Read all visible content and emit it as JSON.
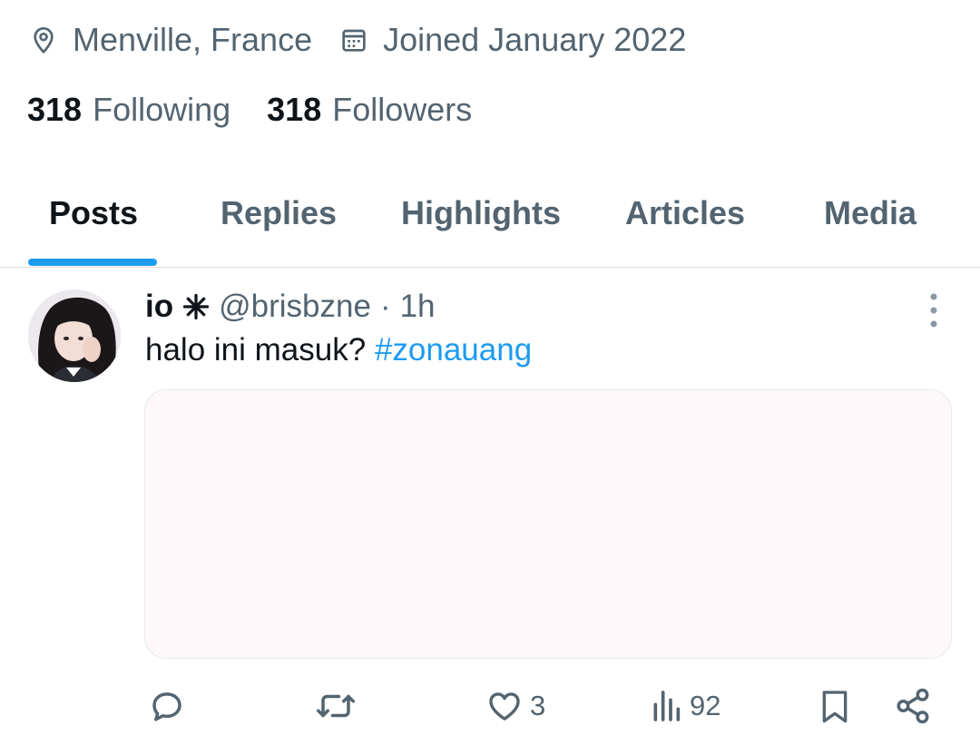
{
  "profile": {
    "location": "Menville, France",
    "joined": "Joined January 2022",
    "following_count": "318",
    "following_label": "Following",
    "followers_count": "318",
    "followers_label": "Followers"
  },
  "tabs": [
    {
      "label": "Posts",
      "active": true
    },
    {
      "label": "Replies",
      "active": false
    },
    {
      "label": "Highlights",
      "active": false
    },
    {
      "label": "Articles",
      "active": false
    },
    {
      "label": "Media",
      "active": false
    }
  ],
  "post": {
    "display_name": "io",
    "handle": "@brisbzne",
    "separator": "·",
    "time": "1h",
    "text": "halo ini masuk?",
    "hashtag": "#zonauang",
    "actions": {
      "reply_count": "",
      "repost_count": "",
      "like_count": "3",
      "views_count": "92"
    }
  },
  "colors": {
    "accent": "#1d9bf0",
    "secondary_text": "#536471",
    "primary_text": "#0f1419",
    "media_background": "#fff8fb"
  },
  "icons": {
    "location": "map-pin-icon",
    "joined": "calendar-icon",
    "name_badge": "star-burst-icon",
    "more": "vertical-ellipsis-icon",
    "reply": "speech-bubble-icon",
    "repost": "repost-arrows-icon",
    "like": "heart-icon",
    "views": "bar-chart-icon",
    "bookmark": "bookmark-icon",
    "share": "share-icon"
  }
}
